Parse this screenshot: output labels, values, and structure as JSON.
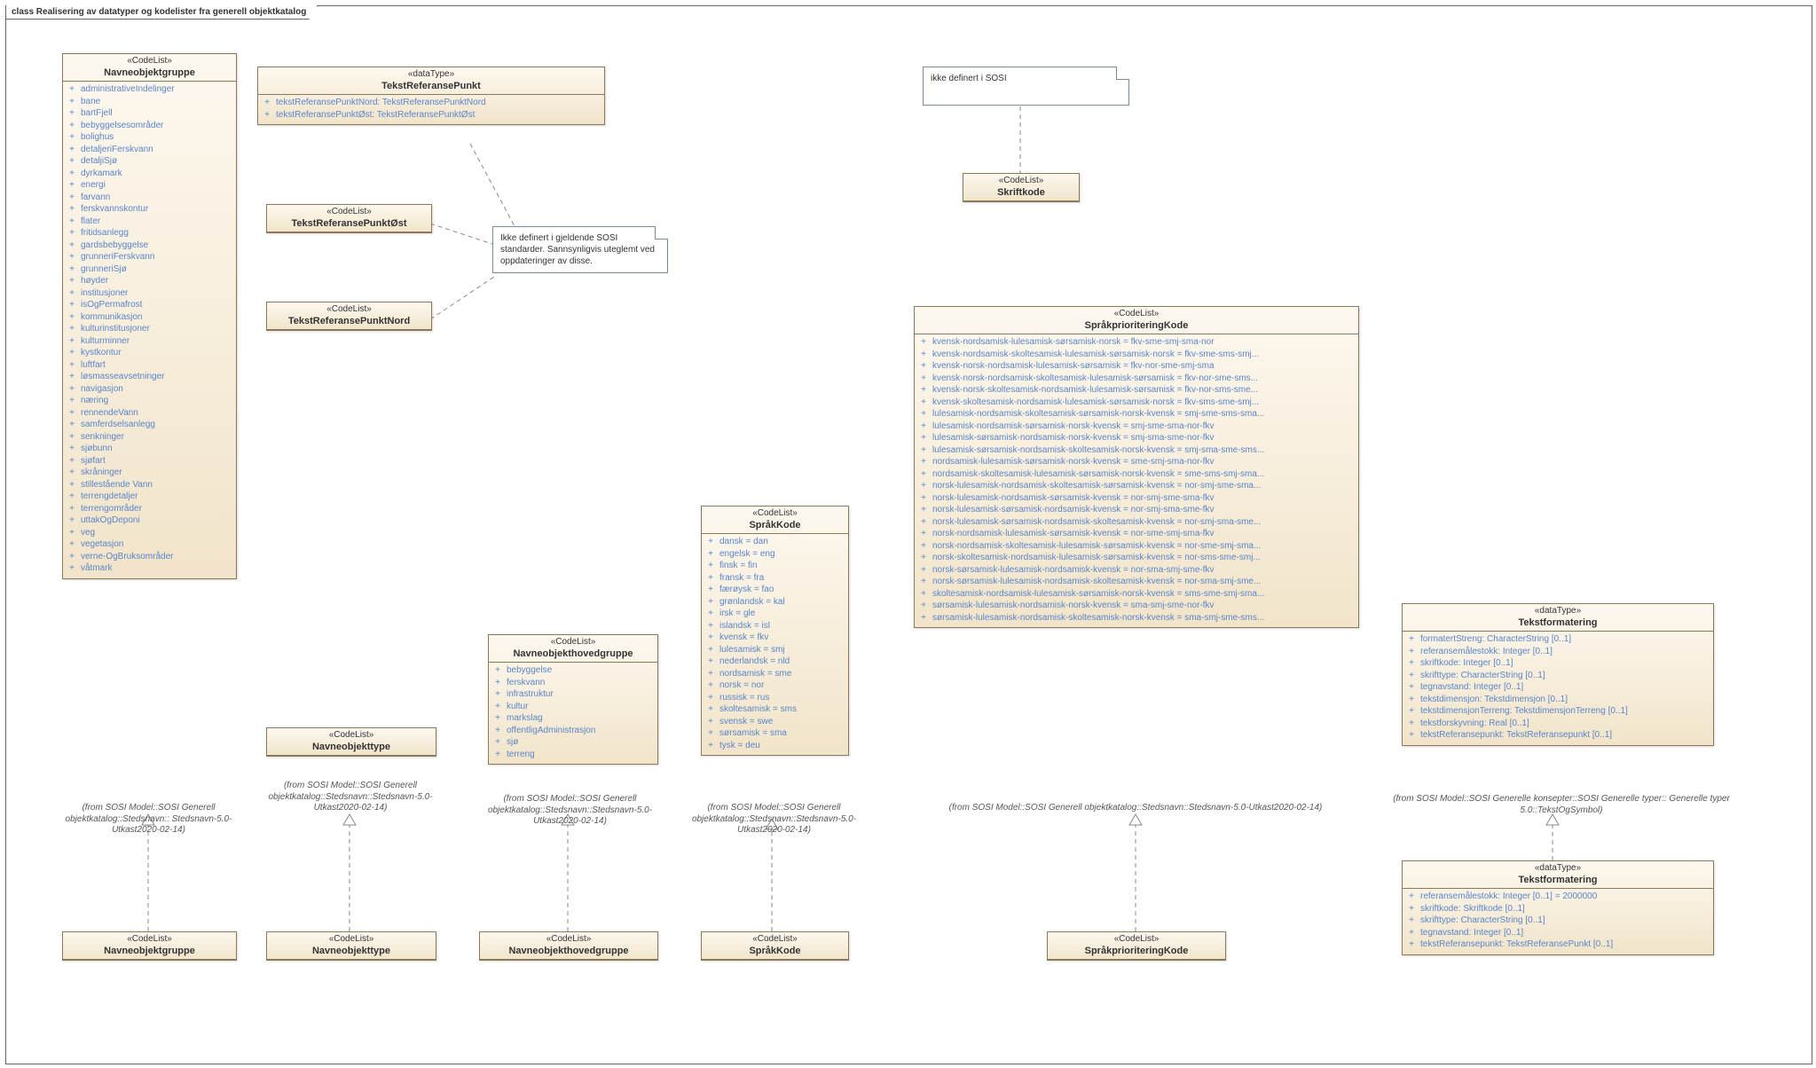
{
  "frame_title": "class Realisering av datatyper og kodelister fra generell objektkatalog",
  "notes": {
    "sosi_undef": "ikke definert i SOSI",
    "tekstref": "Ikke definert i gjeldende SOSI standarder. Sannsynligvis uteglemt ved oppdateringer av disse."
  },
  "captions": {
    "navgrp": "(from SOSI Model::SOSI Generell objektkatalog::Stedsnavn:: Stedsnavn-5.0-Utkast2020-02-14)",
    "navtype": "(from SOSI Model::SOSI Generell objektkatalog::Stedsnavn::Stedsnavn-5.0-Utkast2020-02-14)",
    "navhgrp": "(from SOSI Model::SOSI Generell objektkatalog::Stedsnavn::Stedsnavn-5.0-Utkast2020-02-14)",
    "sprak": "(from SOSI Model::SOSI Generell objektkatalog::Stedsnavn::Stedsnavn-5.0-Utkast2020-02-14)",
    "sprakprio": "(from SOSI Model::SOSI Generell objektkatalog::Stedsnavn::Stedsnavn-5.0-Utkast2020-02-14)",
    "tekstfmt": "(from SOSI Model::SOSI Generelle konsepter::SOSI Generelle typer:: Generelle typer 5.0::TekstOgSymbol)"
  },
  "boxes": {
    "navgrp": {
      "stereo": "«CodeList»",
      "name": "Navneobjektgruppe",
      "items": [
        "administrativeIndelinger",
        "bane",
        "bartFjell",
        "bebyggelsesområder",
        "bolighus",
        "detaljeriFerskvann",
        "detaljiSjø",
        "dyrkamark",
        "energi",
        "farvann",
        "ferskvannskontur",
        "flater",
        "fritidsanlegg",
        "gardsbebyggelse",
        "grunneriFerskvann",
        "grunneriSjø",
        "høyder",
        "institusjoner",
        "isOgPermafrost",
        "kommunikasjon",
        "kulturinstitusjoner",
        "kulturminner",
        "kystkontur",
        "luftfart",
        "løsmasseavsetninger",
        "navigasjon",
        "næring",
        "rennendeVann",
        "samferdselsanlegg",
        "senkninger",
        "sjøbunn",
        "sjøfart",
        "skråninger",
        "stillestående Vann",
        "terrengdetaljer",
        "terrengområder",
        "uttakOgDeponi",
        "veg",
        "vegetasjon",
        "verne-OgBruksområder",
        "våtmark"
      ]
    },
    "tekstrefpunkt": {
      "stereo": "«dataType»",
      "name": "TekstReferansePunkt",
      "items": [
        "tekstReferansePunktNord: TekstReferansePunktNord",
        "tekstReferansePunktØst: TekstReferansePunktØst"
      ]
    },
    "trpost": {
      "stereo": "«CodeList»",
      "name": "TekstReferansePunktØst"
    },
    "trpnord": {
      "stereo": "«CodeList»",
      "name": "TekstReferansePunktNord"
    },
    "skriftkode": {
      "stereo": "«CodeList»",
      "name": "Skriftkode"
    },
    "navtype_top": {
      "stereo": "«CodeList»",
      "name": "Navneobjekttype"
    },
    "navhgrp": {
      "stereo": "«CodeList»",
      "name": "Navneobjekthovedgruppe",
      "items": [
        "bebyggelse",
        "ferskvann",
        "infrastruktur",
        "kultur",
        "markslag",
        "offentligAdministrasjon",
        "sjø",
        "terreng"
      ]
    },
    "sprakkode": {
      "stereo": "«CodeList»",
      "name": "SpråkKode",
      "items": [
        "dansk = dan",
        "engelsk = eng",
        "finsk = fin",
        "fransk = fra",
        "færøysk = fao",
        "grønlandsk = kal",
        "irsk = gle",
        "islandsk = isl",
        "kvensk = fkv",
        "lulesamisk = smj",
        "nederlandsk = nld",
        "nordsamisk = sme",
        "norsk = nor",
        "russisk = rus",
        "skoltesamisk = sms",
        "svensk = swe",
        "sørsamisk = sma",
        "tysk = deu"
      ]
    },
    "sprakprio": {
      "stereo": "«CodeList»",
      "name": "SpråkprioriteringKode",
      "items": [
        "kvensk-nordsamisk-lulesamisk-sørsamisk-norsk = fkv-sme-smj-sma-nor",
        "kvensk-nordsamisk-skoltesamisk-lulesamisk-sørsamisk-norsk = fkv-sme-sms-smj...",
        "kvensk-norsk-nordsamisk-lulesamisk-sørsamisk = fkv-nor-sme-smj-sma",
        "kvensk-norsk-nordsamisk-skoltesamisk-lulesamisk-sørsamisk = fkv-nor-sme-sms...",
        "kvensk-norsk-skoltesamisk-nordsamisk-lulesamisk-sørsamisk = fkv-nor-sms-sme...",
        "kvensk-skoltesamisk-nordsamisk-lulesamisk-sørsamisk-norsk = fkv-sms-sme-smj...",
        "lulesamisk-nordsamisk-skoltesamisk-sørsamisk-norsk-kvensk = smj-sme-sms-sma...",
        "lulesamisk-nordsamisk-sørsamisk-norsk-kvensk = smj-sme-sma-nor-fkv",
        "lulesamisk-sørsamisk-nordsamisk-norsk-kvensk = smj-sma-sme-nor-fkv",
        "lulesamisk-sørsamisk-nordsamisk-skoltesamisk-norsk-kvensk = smj-sma-sme-sms...",
        "nordsamisk-lulesamisk-sørsamisk-norsk-kvensk = sme-smj-sma-nor-fkv",
        "nordsamisk-skoltesamisk-lulesamisk-sørsamisk-norsk-kvensk = sme-sms-smj-sma...",
        "norsk-lulesamisk-nordsamisk-skoltesamisk-sørsamisk-kvensk = nor-smj-sme-sma...",
        "norsk-lulesamisk-nordsamisk-sørsamisk-kvensk = nor-smj-sme-sma-fkv",
        "norsk-lulesamisk-sørsamisk-nordsamisk-kvensk = nor-smj-sma-sme-fkv",
        "norsk-lulesamisk-sørsamisk-nordsamisk-skoltesamisk-kvensk = nor-smj-sma-sme...",
        "norsk-nordsamisk-lulesamisk-sørsamisk-kvensk = nor-sme-smj-sma-fkv",
        "norsk-nordsamisk-skoltesamisk-lulesamisk-sørsamisk-kvensk = nor-sme-smj-sma...",
        "norsk-skoltesamisk-nordsamisk-lulesamisk-sørsamisk-kvensk = nor-sms-sme-smj...",
        "norsk-sørsamisk-lulesamisk-nordsamisk-kvensk = nor-sma-smj-sme-fkv",
        "norsk-sørsamisk-lulesamisk-nordsamisk-skoltesamisk-kvensk = nor-sma-smj-sme...",
        "skoltesamisk-nordsamisk-lulesamisk-sørsamisk-norsk-kvensk = sms-sme-smj-sma...",
        "sørsamisk-lulesamisk-nordsamisk-norsk-kvensk = sma-smj-sme-nor-fkv",
        "sørsamisk-lulesamisk-nordsamisk-skoltesamisk-norsk-kvensk = sma-smj-sme-sms..."
      ]
    },
    "tekstfmt_top": {
      "stereo": "«dataType»",
      "name": "Tekstformatering",
      "items": [
        "formatertStreng: CharacterString [0..1]",
        "referansemålestokk: Integer [0..1]",
        "skriftkode: Integer [0..1]",
        "skrifttype: CharacterString [0..1]",
        "tegnavstand: Integer [0..1]",
        "tekstdimensjon: Tekstdimensjon [0..1]",
        "tekstdimensjonTerreng: TekstdimensjonTerreng [0..1]",
        "tekstforskyvning: Real [0..1]",
        "tekstReferansepunkt: TekstReferansepunkt [0..1]"
      ]
    },
    "tekstfmt_bot": {
      "stereo": "«dataType»",
      "name": "Tekstformatering",
      "items": [
        "referansemålestokk: Integer [0..1] = 2000000",
        "skriftkode: Skriftkode [0..1]",
        "skrifttype: CharacterString [0..1]",
        "tegnavstand: Integer [0..1]",
        "tekstReferansepunkt: TekstReferansePunkt [0..1]"
      ]
    },
    "navgrp_bot": {
      "stereo": "«CodeList»",
      "name": "Navneobjektgruppe"
    },
    "navtype_bot": {
      "stereo": "«CodeList»",
      "name": "Navneobjekttype"
    },
    "navhgrp_bot": {
      "stereo": "«CodeList»",
      "name": "Navneobjekthovedgruppe"
    },
    "sprak_bot": {
      "stereo": "«CodeList»",
      "name": "SpråkKode"
    },
    "sprakprio_bot": {
      "stereo": "«CodeList»",
      "name": "SpråkprioriteringKode"
    }
  }
}
